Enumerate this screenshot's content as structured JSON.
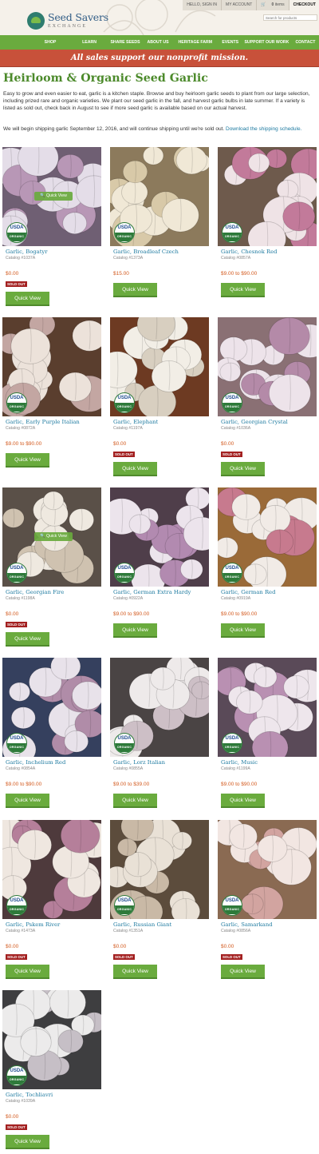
{
  "header": {
    "logo_title": "Seed Savers",
    "logo_sub": "EXCHANGE",
    "util": {
      "hello": "HELLO, SIGN IN",
      "account": "MY ACCOUNT",
      "cart_count": "0",
      "cart_label": "items",
      "checkout": "CHECKOUT"
    },
    "search_placeholder": "Search for products"
  },
  "nav": {
    "items": [
      "SHOP",
      "LEARN",
      "SHARE SEEDS",
      "ABOUT US",
      "HERITAGE FARM",
      "EVENTS",
      "SUPPORT OUR WORK",
      "CONTACT"
    ]
  },
  "banner": {
    "text": "All sales support our nonprofit mission."
  },
  "page": {
    "title": "Heirloom & Organic Seed Garlic",
    "intro": "Easy to grow and even easier to eat, garlic is a kitchen staple. Browse and buy heirloom garlic seeds to plant from our large selection, including prized rare and organic varieties. We plant our seed garlic in the fall, and harvest garlic bulbs in late summer. If a variety is listed as sold out, check back in August to see if more seed garlic is available based on our actual harvest.",
    "shipping_text": "We will begin shipping garlic September 12, 2016, and will continue shipping until we're sold out.",
    "shipping_link": "Download the shipping schedule."
  },
  "badges": {
    "usda": "USDA",
    "organic": "ORGANIC",
    "sold_out": "SOLD OUT"
  },
  "quick_view_label": "Quick View",
  "products": [
    {
      "name": "Garlic, Bogatyr",
      "catalog": "Catalog #1037A",
      "price": "$0.00",
      "sold_out": true,
      "overlay": true,
      "colors": [
        "#6f5f73",
        "#e4dde8",
        "#b897b6"
      ]
    },
    {
      "name": "Garlic, Broadleaf Czech",
      "catalog": "Catalog #1373A",
      "price": "$15.00",
      "sold_out": false,
      "overlay": false,
      "colors": [
        "#8c7a5c",
        "#f0e8d6",
        "#d8c9a8"
      ]
    },
    {
      "name": "Garlic, Chesnok Red",
      "catalog": "Catalog #0857A",
      "price": "$9.00 to $90.00",
      "sold_out": false,
      "overlay": false,
      "colors": [
        "#6e5a4c",
        "#efe3e6",
        "#c27a9a"
      ]
    },
    {
      "name": "Garlic, Early Purple Italian",
      "catalog": "Catalog #0872A",
      "price": "$9.00 to $90.00",
      "sold_out": false,
      "overlay": false,
      "colors": [
        "#5a3e2e",
        "#ece2da",
        "#c3a6a2"
      ]
    },
    {
      "name": "Garlic, Elephant",
      "catalog": "Catalog #1197A",
      "price": "$0.00",
      "sold_out": true,
      "overlay": false,
      "colors": [
        "#6d3a22",
        "#f2eee6",
        "#d8cfc0"
      ]
    },
    {
      "name": "Garlic, Georgian Crystal",
      "catalog": "Catalog #1036A",
      "price": "$0.00",
      "sold_out": true,
      "overlay": false,
      "colors": [
        "#8a7074",
        "#ede3ea",
        "#b48aa8"
      ]
    },
    {
      "name": "Garlic, Georgian Fire",
      "catalog": "Catalog #1198A",
      "price": "$0.00",
      "sold_out": true,
      "overlay": true,
      "colors": [
        "#5a5048",
        "#efe9e0",
        "#cfc2b0"
      ]
    },
    {
      "name": "Garlic, German Extra Hardy",
      "catalog": "Catalog #0922A",
      "price": "$9.00 to $90.00",
      "sold_out": false,
      "overlay": false,
      "colors": [
        "#4f3e4a",
        "#ece4ec",
        "#b28ab0"
      ]
    },
    {
      "name": "Garlic, German Red",
      "catalog": "Catalog #0919A",
      "price": "$9.00 to $90.00",
      "sold_out": false,
      "overlay": false,
      "colors": [
        "#9a6a38",
        "#f1ebe6",
        "#c77a8e"
      ]
    },
    {
      "name": "Garlic, Inchelium Red",
      "catalog": "Catalog #0854A",
      "price": "$9.00 to $90.00",
      "sold_out": false,
      "overlay": false,
      "colors": [
        "#35405e",
        "#e8e2ea",
        "#b08ca8"
      ]
    },
    {
      "name": "Garlic, Lorz Italian",
      "catalog": "Catalog #0855A",
      "price": "$9.00 to $39.00",
      "sold_out": false,
      "overlay": false,
      "colors": [
        "#4a4444",
        "#eeeaea",
        "#cdbfc6"
      ]
    },
    {
      "name": "Garlic, Music",
      "catalog": "Catalog #1199A",
      "price": "$9.00 to $90.00",
      "sold_out": false,
      "overlay": false,
      "colors": [
        "#5a4a58",
        "#eee6ec",
        "#b990b2"
      ]
    },
    {
      "name": "Garlic, Pskem River",
      "catalog": "Catalog #1473A",
      "price": "$0.00",
      "sold_out": true,
      "overlay": false,
      "colors": [
        "#4e3a3c",
        "#efe7e0",
        "#b57f9a"
      ]
    },
    {
      "name": "Garlic, Russian Giant",
      "catalog": "Catalog #1351A",
      "price": "$0.00",
      "sold_out": true,
      "overlay": false,
      "colors": [
        "#5c4c3c",
        "#e9e1d6",
        "#c9b9a6"
      ]
    },
    {
      "name": "Garlic, Samarkand",
      "catalog": "Catalog #0856A",
      "price": "$0.00",
      "sold_out": true,
      "overlay": false,
      "colors": [
        "#8a6a52",
        "#f2e6e2",
        "#d2a4a0"
      ]
    },
    {
      "name": "Garlic, Tochliavri",
      "catalog": "Catalog #1039A",
      "price": "$0.00",
      "sold_out": true,
      "overlay": false,
      "colors": [
        "#3e3e40",
        "#ecebeb",
        "#c6bfc6"
      ]
    }
  ],
  "colors": {
    "green": "#6aab3e",
    "banner_red": "#c8513a",
    "price_orange": "#d35a1e",
    "link_blue": "#1d7aa0",
    "sold_out_red": "#a32020"
  }
}
